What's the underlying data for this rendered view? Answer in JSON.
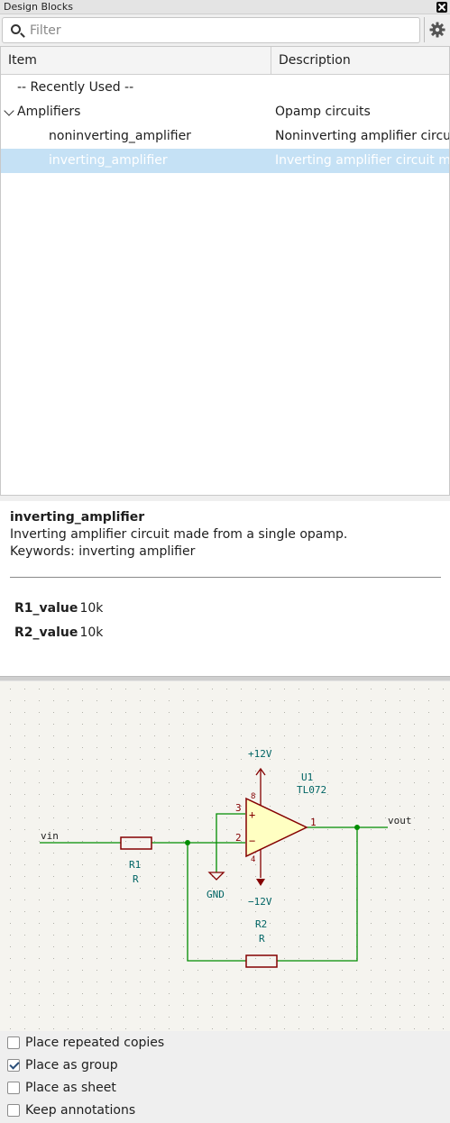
{
  "window": {
    "title": "Design Blocks"
  },
  "toolbar": {
    "filter_placeholder": "Filter"
  },
  "tree": {
    "columns": [
      "Item",
      "Description"
    ],
    "rows": [
      {
        "item": "-- Recently Used --",
        "description": ""
      },
      {
        "item": "Amplifiers",
        "description": "Opamp circuits"
      },
      {
        "item": "noninverting_amplifier",
        "description": "Noninverting amplifier circuit m"
      },
      {
        "item": "inverting_amplifier",
        "description": "Inverting amplifier circuit made"
      }
    ]
  },
  "details": {
    "name": "inverting_amplifier",
    "description": "Inverting amplifier circuit made from a single opamp.",
    "keywords": "Keywords: inverting amplifier",
    "fields": [
      {
        "name": "R1_value",
        "value": "10k"
      },
      {
        "name": "R2_value",
        "value": "10k"
      }
    ]
  },
  "schematic": {
    "labels": {
      "vin": "vin",
      "vout": "vout",
      "r1_ref": "R1",
      "r1_val": "R",
      "r2_ref": "R2",
      "r2_val": "R",
      "u1_ref": "U1",
      "u1_val": "TL072",
      "pos_supply": "+12V",
      "neg_supply": "−12V",
      "gnd": "GND",
      "pin1": "1",
      "pin2": "2",
      "pin3": "3",
      "pin4": "4",
      "pin8": "8",
      "plus": "+",
      "minus": "−"
    },
    "colors": {
      "wire": "#008c00",
      "component": "#840000",
      "ref_text": "#006464",
      "opamp_fill": "#ffffc2",
      "grid": "#b0b0a8"
    }
  },
  "options": [
    {
      "label": "Place repeated copies",
      "checked": false
    },
    {
      "label": "Place as group",
      "checked": true
    },
    {
      "label": "Place as sheet",
      "checked": false
    },
    {
      "label": "Keep annotations",
      "checked": false
    }
  ]
}
